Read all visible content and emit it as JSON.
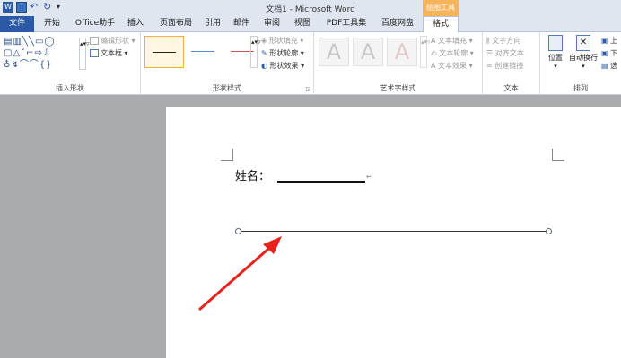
{
  "window": {
    "title": "文档1 - Microsoft Word",
    "context_tab_group": "绘图工具"
  },
  "tabs": [
    "文件",
    "开始",
    "Office助手",
    "插入",
    "页面布局",
    "引用",
    "邮件",
    "审阅",
    "视图",
    "PDF工具集",
    "百度网盘",
    "格式"
  ],
  "ribbon": {
    "insert_shapes": {
      "edit_shape": "编辑形状",
      "text_box": "文本框",
      "label": "插入形状"
    },
    "shape_styles": {
      "fill": "形状填充",
      "outline": "形状轮廓",
      "effects": "形状效果",
      "label": "形状样式"
    },
    "wordart": {
      "glyph": "A",
      "text_fill": "文本填充",
      "text_outline": "文本轮廓",
      "text_effects": "文本效果",
      "label": "艺术字样式"
    },
    "text": {
      "direction": "文字方向",
      "align": "对齐文本",
      "link": "创建链接",
      "label": "文本"
    },
    "arrange": {
      "position": "位置",
      "wrap": "自动换行",
      "up": "上",
      "down": "下",
      "select": "选",
      "label": "排列"
    }
  },
  "document": {
    "name_label": "姓名：",
    "para_mark": "↵"
  }
}
